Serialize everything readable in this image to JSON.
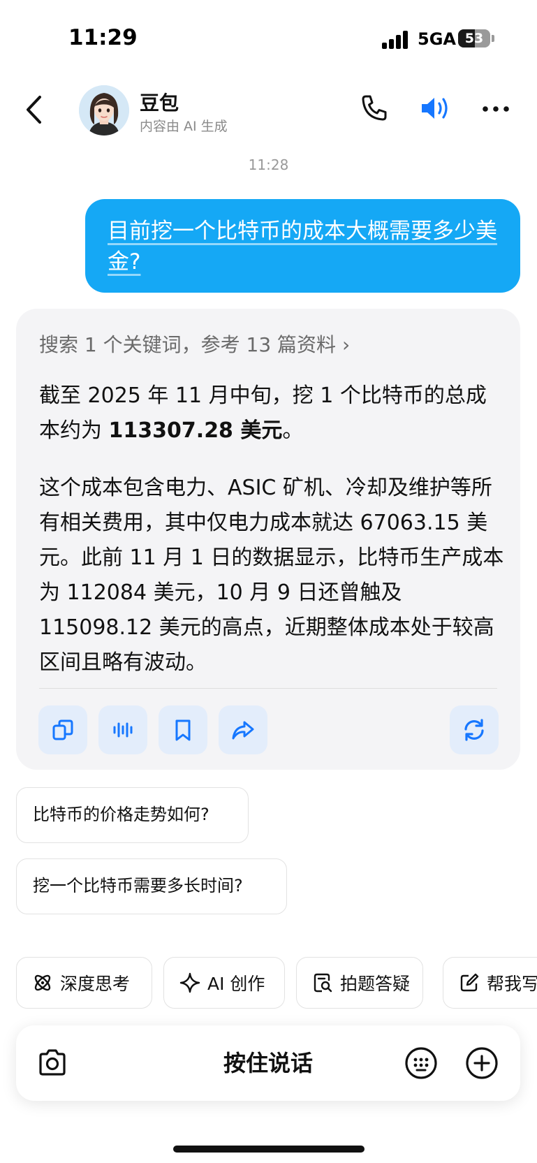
{
  "status_bar": {
    "time": "11:29",
    "network": "5GA",
    "battery": "53",
    "battery_level": 0.53
  },
  "header": {
    "name": "豆包",
    "subtitle": "内容由 AI 生成"
  },
  "timestamp": "11:28",
  "user_message": "目前挖一个比特币的成本大概需要多少美金?",
  "ai_card": {
    "search_ref": "搜索 1 个关键词，参考 13 篇资料 ›",
    "p1_before": "截至 2025 年 11 月中旬，挖 1 个比特币的总成本约为 ",
    "p1_bold": "113307.28 美元",
    "p1_after": "。",
    "p2": "这个成本包含电力、ASIC 矿机、冷却及维护等所有相关费用，其中仅电力成本就达 67063.15 美元。此前 11 月 1 日的数据显示，比特币生产成本为 112084 美元，10 月 9 日还曾触及 115098.12 美元的高点，近期整体成本处于较高区间且略有波动。"
  },
  "suggestions": [
    "比特币的价格走势如何?",
    "挖一个比特币需要多长时间?"
  ],
  "tools": [
    {
      "label": "深度思考",
      "icon": "atom-icon"
    },
    {
      "label": "AI 创作",
      "icon": "sparkle-icon"
    },
    {
      "label": "拍题答疑",
      "icon": "search-doc-icon"
    },
    {
      "label": "帮我写",
      "icon": "edit-icon"
    }
  ],
  "input_bar": {
    "hold_to_talk": "按住说话"
  },
  "colors": {
    "accent": "#1677ff",
    "user_bubble": "#15a8f5",
    "card_bg": "#f4f4f6"
  }
}
